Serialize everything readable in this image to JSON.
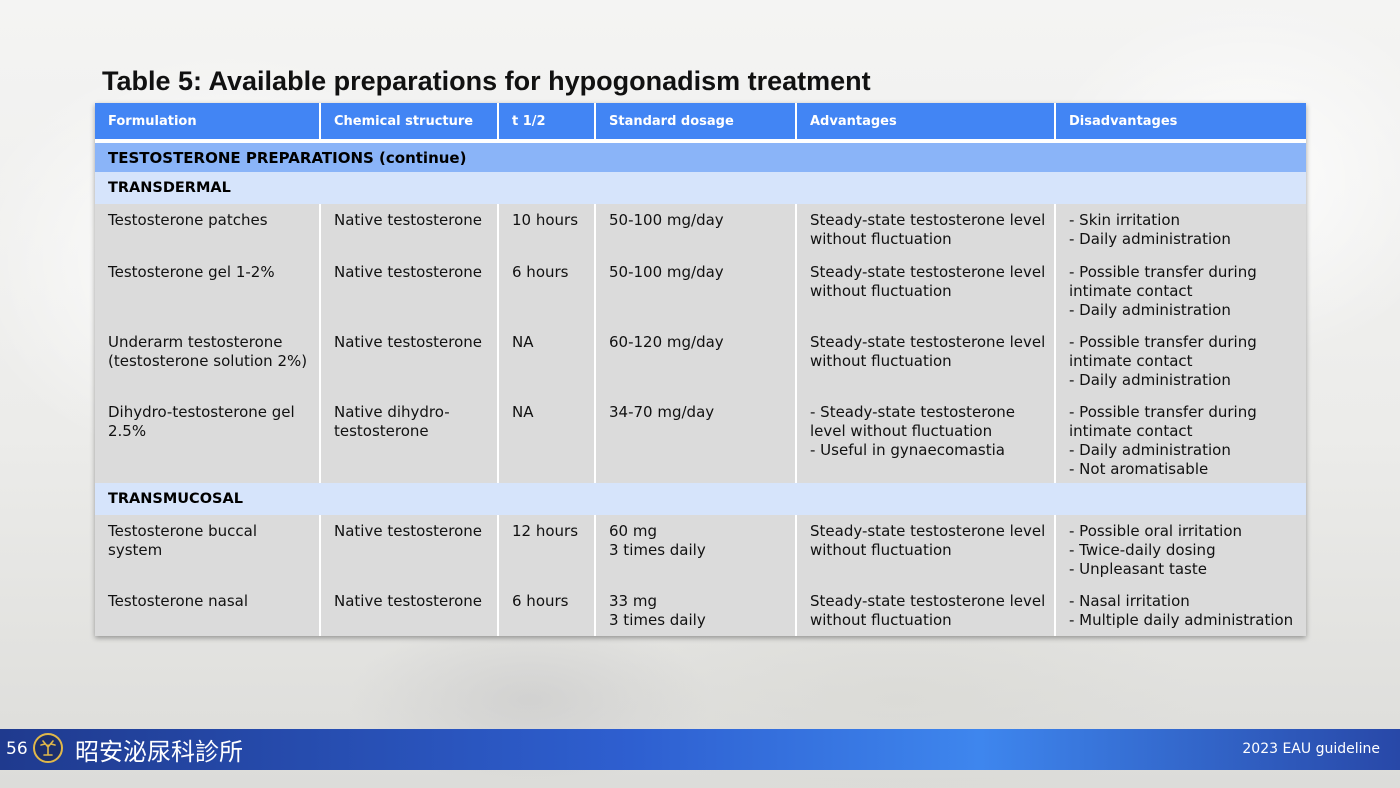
{
  "title": "Table 5: Available preparations for hypogonadism treatment",
  "table": {
    "headers": [
      "Formulation",
      "Chemical structure",
      "t 1/2",
      "Standard dosage",
      "Advantages",
      "Disadvantages"
    ],
    "section": "TESTOSTERONE PREPARATIONS (continue)",
    "groups": [
      {
        "name": "TRANSDERMAL",
        "rows": [
          [
            "Testosterone patches",
            "Native testosterone",
            "10 hours",
            "50-100 mg/day",
            "Steady-state testosterone level\nwithout fluctuation",
            "- Skin irritation\n- Daily administration"
          ],
          [
            "Testosterone gel 1-2%",
            "Native testosterone",
            "6 hours",
            "50-100 mg/day",
            "Steady-state testosterone level\nwithout fluctuation",
            "- Possible transfer during\nintimate contact\n- Daily administration"
          ],
          [
            "Underarm testosterone\n(testosterone solution 2%)",
            "Native testosterone",
            "NA",
            "60-120 mg/day",
            "Steady-state testosterone level\nwithout fluctuation",
            "- Possible transfer during\nintimate contact\n- Daily administration"
          ],
          [
            "Dihydro-testosterone gel\n2.5%",
            "Native dihydro-\ntestosterone",
            "NA",
            "34-70 mg/day",
            "- Steady-state testosterone\nlevel without fluctuation\n- Useful in gynaecomastia",
            "- Possible transfer during\nintimate contact\n- Daily administration\n- Not aromatisable"
          ]
        ]
      },
      {
        "name": "TRANSMUCOSAL",
        "rows": [
          [
            "Testosterone buccal\nsystem",
            "Native testosterone",
            "12 hours",
            "60 mg\n3 times daily",
            "Steady-state testosterone level\nwithout fluctuation",
            "- Possible oral irritation\n- Twice-daily dosing\n- Unpleasant taste"
          ],
          [
            "Testosterone nasal",
            "Native testosterone",
            "6 hours",
            "33 mg\n3 times daily",
            "Steady-state testosterone level\nwithout fluctuation",
            "- Nasal irritation\n- Multiple daily administration"
          ]
        ]
      }
    ]
  },
  "footer": {
    "page_number": "56",
    "clinic_name": "昭安泌尿科診所",
    "guideline": "2023 EAU guideline",
    "logo_icon": "clinic-logo-icon",
    "accent_color": "#4285f4",
    "footer_color": "#2e5fd0"
  }
}
